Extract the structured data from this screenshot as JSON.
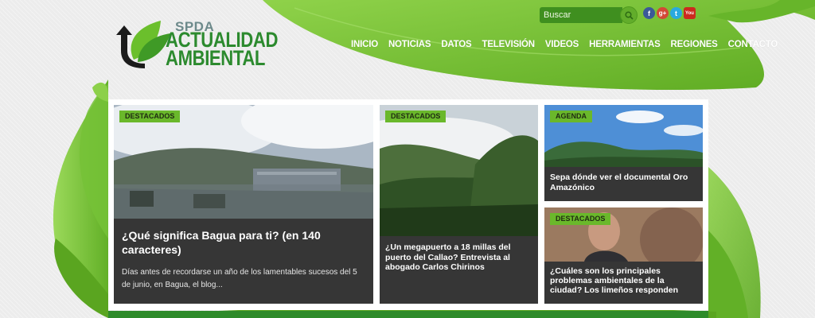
{
  "brand": {
    "top_line": "SPDA",
    "name_line1": "ACTUALIDAD",
    "name_line2": "AMBIENTAL"
  },
  "colors": {
    "leaf_green": "#76c237",
    "dark_green": "#2c8a2e",
    "badge_green": "#6ab82b",
    "card_dark": "#363636"
  },
  "search": {
    "placeholder": "Buscar",
    "icon": "search-icon"
  },
  "social": [
    {
      "label": "f",
      "icon": "facebook-icon"
    },
    {
      "label": "g+",
      "icon": "google-plus-icon"
    },
    {
      "label": "t",
      "icon": "twitter-icon"
    },
    {
      "label": "You",
      "icon": "youtube-icon"
    }
  ],
  "nav": [
    "INICIO",
    "NOTICIAS",
    "DATOS",
    "TELEVISIÓN",
    "VIDEOS",
    "HERRAMIENTAS",
    "REGIONES",
    "CONTACTO"
  ],
  "cards": [
    {
      "badge": "DESTACADOS",
      "title": "¿Qué significa Bagua para ti? (en 140 caracteres)",
      "excerpt": "Días antes de recordarse un año de los lamentables sucesos del 5 de junio, en Bagua, el blog..."
    },
    {
      "badge": "DESTACADOS",
      "title": "¿Un megapuerto a 18 millas del puerto del Callao? Entrevista al abogado Carlos Chirinos"
    },
    {
      "badge": "AGENDA",
      "title": "Sepa dónde ver el documental Oro Amazónico"
    },
    {
      "badge": "DESTACADOS",
      "title": "¿Cuáles son los principales problemas ambientales de la ciudad? Los limeños responden"
    }
  ]
}
